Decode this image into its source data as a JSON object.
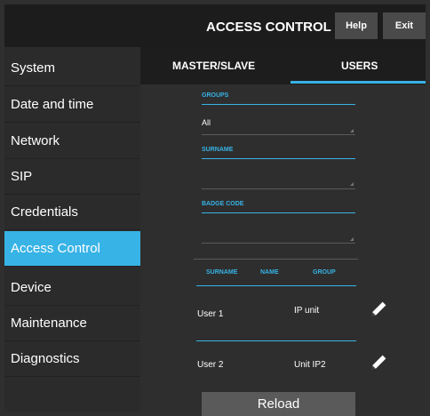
{
  "header": {
    "title": "ACCESS CONTROL",
    "help_label": "Help",
    "exit_label": "Exit"
  },
  "sidebar": {
    "items": [
      {
        "label": "System"
      },
      {
        "label": "Date and time"
      },
      {
        "label": "Network"
      },
      {
        "label": "SIP"
      },
      {
        "label": "Credentials"
      },
      {
        "label": "Access Control",
        "active": true
      },
      {
        "label": "Device"
      },
      {
        "label": "Maintenance"
      },
      {
        "label": "Diagnostics"
      }
    ]
  },
  "tabs": {
    "master_slave": "MASTER/SLAVE",
    "users": "USERS",
    "active": "USERS"
  },
  "filters": {
    "groups_label": "GROUPS",
    "groups_value": "All",
    "surname_label": "SURNAME",
    "surname_value": "",
    "badge_label": "BADGE CODE",
    "badge_value": ""
  },
  "table": {
    "headers": [
      "SURNAME",
      "NAME",
      "GROUP"
    ],
    "rows": [
      {
        "surname": "User 1",
        "group": "IP unit"
      },
      {
        "surname": "User 2",
        "group": "Unit IP2"
      }
    ]
  },
  "reload_label": "Reload",
  "colors": {
    "accent": "#37b3e6",
    "header_bg": "#1c1c1c",
    "panel_bg": "#2b2b2b"
  }
}
